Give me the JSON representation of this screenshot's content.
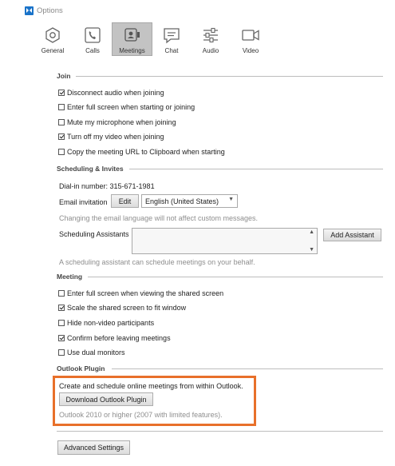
{
  "window": {
    "title": "Options"
  },
  "tabs": [
    {
      "label": "General",
      "icon": "gear-icon"
    },
    {
      "label": "Calls",
      "icon": "phone-icon"
    },
    {
      "label": "Meetings",
      "icon": "meetings-icon",
      "selected": true
    },
    {
      "label": "Chat",
      "icon": "chat-icon"
    },
    {
      "label": "Audio",
      "icon": "sliders-icon"
    },
    {
      "label": "Video",
      "icon": "video-camera-icon"
    }
  ],
  "join": {
    "header": "Join",
    "options": [
      {
        "label": "Disconnect audio when joining",
        "checked": true
      },
      {
        "label": "Enter full screen when starting or joining",
        "checked": false
      },
      {
        "label": "Mute my microphone when joining",
        "checked": false
      },
      {
        "label": "Turn off my video when joining",
        "checked": true
      },
      {
        "label": "Copy the meeting URL to Clipboard when starting",
        "checked": false
      }
    ]
  },
  "scheduling": {
    "header": "Scheduling & Invites",
    "dial_in": "Dial-in number: 315-671-1981",
    "email_label": "Email invitation",
    "edit_button": "Edit",
    "language_value": "English (United States)",
    "language_note": "Changing the email language will not affect custom messages.",
    "assistants_label": "Scheduling Assistants",
    "add_assistant_button": "Add Assistant",
    "assistant_note": "A scheduling assistant can schedule meetings on your behalf."
  },
  "meeting": {
    "header": "Meeting",
    "options": [
      {
        "label": "Enter full screen when viewing the shared screen",
        "checked": false
      },
      {
        "label": "Scale the shared screen to fit window",
        "checked": true
      },
      {
        "label": "Hide non-video participants",
        "checked": false
      },
      {
        "label": "Confirm before leaving meetings",
        "checked": true
      },
      {
        "label": "Use dual monitors",
        "checked": false
      }
    ]
  },
  "outlook": {
    "header": "Outlook Plugin",
    "description": "Create and schedule online meetings from within Outlook.",
    "download_button": "Download Outlook Plugin",
    "compat_note": "Outlook 2010 or higher (2007 with limited features)."
  },
  "advanced_button": "Advanced Settings",
  "colors": {
    "highlight": "#e8702a",
    "selected_tab": "#c3c3c3",
    "app_icon": "#1a73c9"
  }
}
